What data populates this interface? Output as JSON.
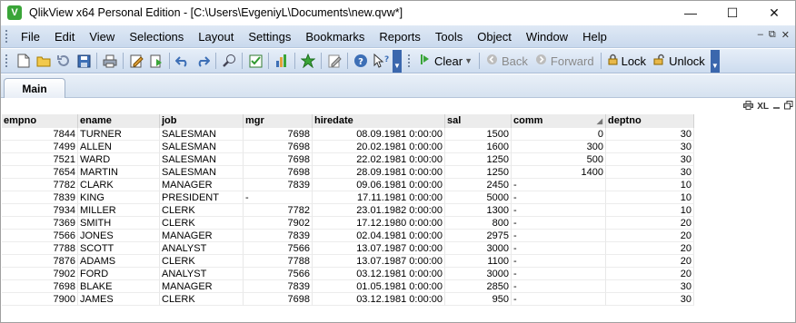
{
  "window": {
    "app_icon": "V",
    "title": "QlikView x64 Personal Edition - [C:\\Users\\EvgeniyL\\Documents\\new.qvw*]",
    "controls": {
      "minimize": "—",
      "maximize": "☐",
      "close": "✕"
    }
  },
  "menubar": {
    "items": [
      "File",
      "Edit",
      "View",
      "Selections",
      "Layout",
      "Settings",
      "Bookmarks",
      "Reports",
      "Tools",
      "Object",
      "Window",
      "Help"
    ],
    "right_icons": [
      "minimize-doc-icon",
      "restore-doc-icon",
      "close-doc-icon"
    ],
    "right_glyphs": [
      "–",
      "⧉",
      "✕"
    ]
  },
  "toolbar": {
    "clear_label": "Clear",
    "back_label": "Back",
    "forward_label": "Forward",
    "lock_label": "Lock",
    "unlock_label": "Unlock",
    "icons": [
      "new-icon",
      "open-icon",
      "reload-icon",
      "save-icon",
      "print-icon",
      "edit-script-icon",
      "reload-data-icon",
      "undo-icon",
      "redo-icon",
      "search-icon",
      "checkbox-icon",
      "chart-icon",
      "star-icon",
      "edit-icon",
      "help-icon",
      "whats-this-icon"
    ]
  },
  "tabs": [
    {
      "label": "Main"
    }
  ],
  "table_caption": {
    "xl_label": "XL",
    "icons": [
      "print-icon",
      "xl-icon",
      "minimize-icon",
      "restore-icon"
    ]
  },
  "table": {
    "columns": [
      "empno",
      "ename",
      "job",
      "mgr",
      "hiredate",
      "sal",
      "comm",
      "deptno"
    ],
    "rows": [
      [
        "7844",
        "TURNER",
        "SALESMAN",
        "7698",
        "08.09.1981 0:00:00",
        "1500",
        "0",
        "30"
      ],
      [
        "7499",
        "ALLEN",
        "SALESMAN",
        "7698",
        "20.02.1981 0:00:00",
        "1600",
        "300",
        "30"
      ],
      [
        "7521",
        "WARD",
        "SALESMAN",
        "7698",
        "22.02.1981 0:00:00",
        "1250",
        "500",
        "30"
      ],
      [
        "7654",
        "MARTIN",
        "SALESMAN",
        "7698",
        "28.09.1981 0:00:00",
        "1250",
        "1400",
        "30"
      ],
      [
        "7782",
        "CLARK",
        "MANAGER",
        "7839",
        "09.06.1981 0:00:00",
        "2450",
        "-",
        "10"
      ],
      [
        "7839",
        "KING",
        "PRESIDENT",
        "-",
        "17.11.1981 0:00:00",
        "5000",
        "-",
        "10"
      ],
      [
        "7934",
        "MILLER",
        "CLERK",
        "7782",
        "23.01.1982 0:00:00",
        "1300",
        "-",
        "10"
      ],
      [
        "7369",
        "SMITH",
        "CLERK",
        "7902",
        "17.12.1980 0:00:00",
        "800",
        "-",
        "20"
      ],
      [
        "7566",
        "JONES",
        "MANAGER",
        "7839",
        "02.04.1981 0:00:00",
        "2975",
        "-",
        "20"
      ],
      [
        "7788",
        "SCOTT",
        "ANALYST",
        "7566",
        "13.07.1987 0:00:00",
        "3000",
        "-",
        "20"
      ],
      [
        "7876",
        "ADAMS",
        "CLERK",
        "7788",
        "13.07.1987 0:00:00",
        "1100",
        "-",
        "20"
      ],
      [
        "7902",
        "FORD",
        "ANALYST",
        "7566",
        "03.12.1981 0:00:00",
        "3000",
        "-",
        "20"
      ],
      [
        "7698",
        "BLAKE",
        "MANAGER",
        "7839",
        "01.05.1981 0:00:00",
        "2850",
        "-",
        "30"
      ],
      [
        "7900",
        "JAMES",
        "CLERK",
        "7698",
        "03.12.1981 0:00:00",
        "950",
        "-",
        "30"
      ]
    ]
  },
  "colors": {
    "brand": "#3aa538",
    "menubar": "#c9d9ed",
    "accent": "#3b67ad"
  }
}
